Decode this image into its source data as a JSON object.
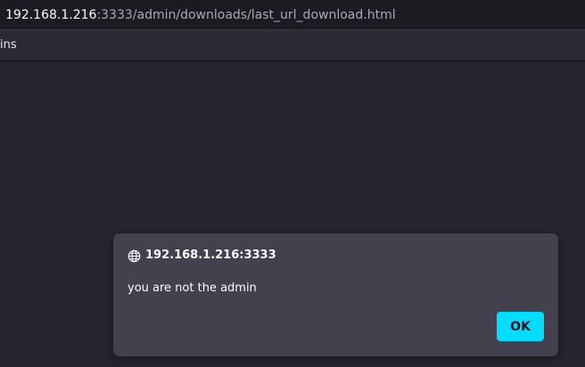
{
  "address_bar": {
    "host": "192.168.1.216",
    "rest": ":3333/admin/downloads/last_url_download.html"
  },
  "bookmarks": {
    "items": [
      "ins"
    ]
  },
  "dialog": {
    "icon": "globe-icon",
    "title": "192.168.1.216:3333",
    "message": "you are not the admin",
    "ok_label": "OK"
  },
  "colors": {
    "accent": "#00ddff",
    "page_background": "#25242f",
    "dialog_background": "#42414d"
  }
}
